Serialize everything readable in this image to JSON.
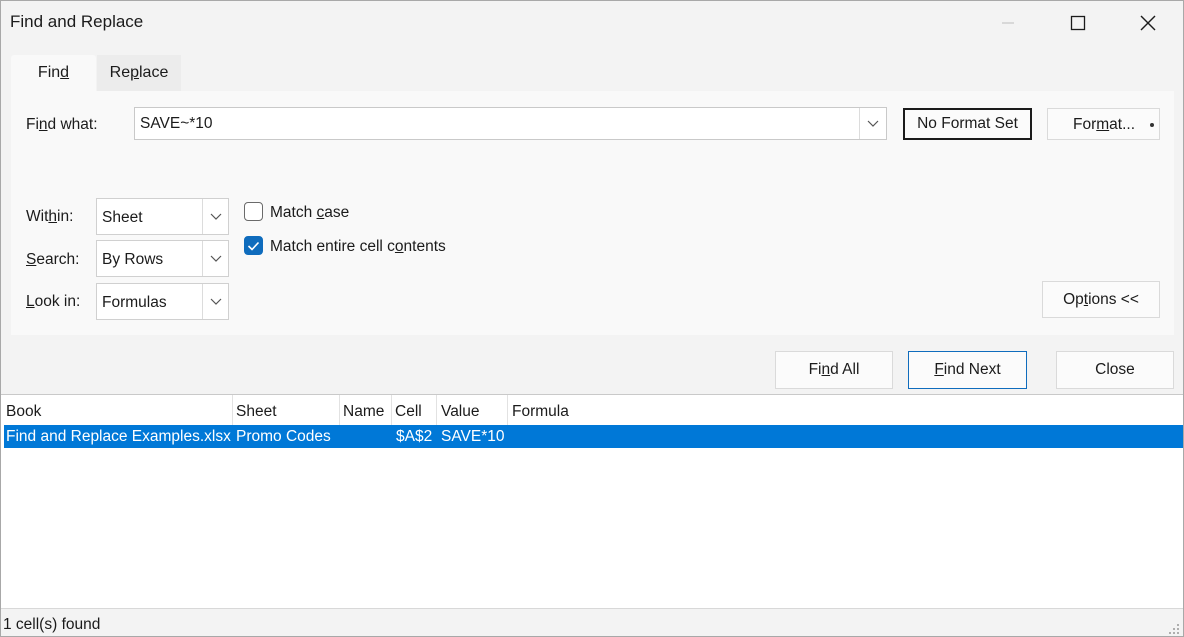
{
  "window": {
    "title": "Find and Replace"
  },
  "tabs": [
    {
      "label_pre": "Fin",
      "label_key": "d",
      "label_post": ""
    },
    {
      "label_pre": "Re",
      "label_key": "p",
      "label_post": "lace"
    }
  ],
  "find": {
    "label_pre": "Fi",
    "label_key": "n",
    "label_post": "d what:",
    "value": "SAVE~*10",
    "no_format_label": "No Format Set",
    "format_pre": "For",
    "format_key": "m",
    "format_post": "at..."
  },
  "within": {
    "label_pre": "Wit",
    "label_key": "h",
    "label_post": "in:",
    "value": "Sheet"
  },
  "search": {
    "label_pre": "",
    "label_key": "S",
    "label_post": "earch:",
    "value": "By Rows"
  },
  "lookin": {
    "label_pre": "",
    "label_key": "L",
    "label_post": "ook in:",
    "value": "Formulas"
  },
  "match_case": {
    "label_pre": "Match ",
    "label_key": "c",
    "label_post": "ase",
    "checked": false
  },
  "match_entire": {
    "label_pre": "Match entire cell c",
    "label_key": "o",
    "label_post": "ntents",
    "checked": true
  },
  "options_btn": {
    "pre": "Op",
    "key": "t",
    "post": "ions <<"
  },
  "buttons": {
    "find_all": {
      "pre": "Fi",
      "key": "n",
      "post": "d All"
    },
    "find_next": {
      "pre": "",
      "key": "F",
      "post": "ind Next"
    },
    "close": "Close"
  },
  "results": {
    "columns": [
      "Book",
      "Sheet",
      "Name",
      "Cell",
      "Value",
      "Formula"
    ],
    "rows": [
      {
        "book": "Find and Replace Examples.xlsx",
        "sheet": "Promo Codes",
        "name": "",
        "cell": "$A$2",
        "value": "SAVE*10",
        "formula": ""
      }
    ]
  },
  "status": "1 cell(s) found",
  "colors": {
    "accent": "#0f6cbd",
    "selection": "#0078d7"
  }
}
